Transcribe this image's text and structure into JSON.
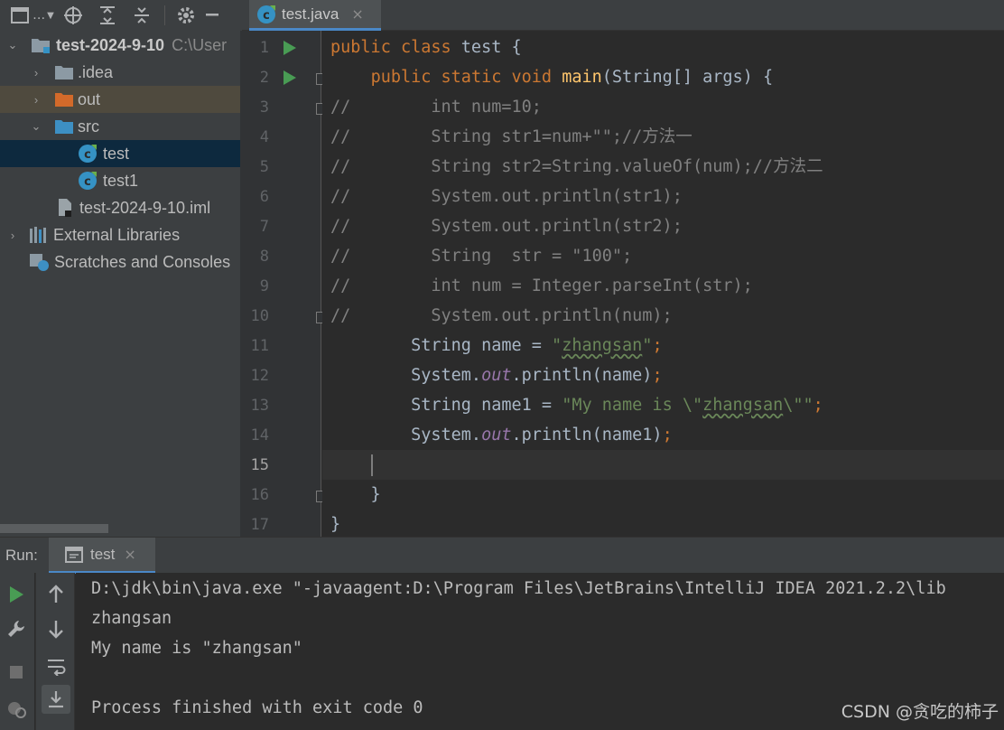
{
  "toolbar": {
    "project_menu": "…"
  },
  "editor_tab": {
    "label": "test.java",
    "close": "×"
  },
  "project_tree": [
    {
      "label": "test-2024-9-10",
      "hint": "C:\\User",
      "chevron": "⌄",
      "icon": "module-folder-icon"
    },
    {
      "label": ".idea",
      "chevron": "›",
      "icon": "folder-icon"
    },
    {
      "label": "out",
      "chevron": "›",
      "icon": "excluded-folder-icon"
    },
    {
      "label": "src",
      "chevron": "⌄",
      "icon": "source-folder-icon"
    },
    {
      "label": "test",
      "icon": "java-class-icon"
    },
    {
      "label": "test1",
      "icon": "java-class-icon"
    },
    {
      "label": "test-2024-9-10.iml",
      "icon": "iml-file-icon"
    },
    {
      "label": "External Libraries",
      "chevron": "›",
      "icon": "libraries-icon"
    },
    {
      "label": "Scratches and Consoles",
      "icon": "scratches-icon"
    }
  ],
  "line_numbers": [
    "1",
    "2",
    "3",
    "4",
    "5",
    "6",
    "7",
    "8",
    "9",
    "10",
    "11",
    "12",
    "13",
    "14",
    "15",
    "16",
    "17"
  ],
  "code": {
    "l1_kw": "public class ",
    "l1_rest": "test {",
    "l2_indent": "    ",
    "l2_kw": "public static void ",
    "l2_fn": "main",
    "l2_rest": "(String[] args) {",
    "l3": "//        int num=10;",
    "l4": "//        String str1=num+\"\";//方法一",
    "l5": "//        String str2=String.valueOf(num);//方法二",
    "l6": "//        System.out.println(str1);",
    "l7": "//        System.out.println(str2);",
    "l8": "//        String  str = \"100\";",
    "l9": "//        int num = Integer.parseInt(str);",
    "l10": "//        System.out.println(num);",
    "l11_a": "        String name = ",
    "l11_q1": "\"",
    "l11_s": "zhangsan",
    "l11_q2": "\"",
    "l11_semi": ";",
    "l12_a": "        System.",
    "l12_f": "out",
    "l12_b": ".println(name)",
    "l12_semi": ";",
    "l13_a": "        String name1 = ",
    "l13_s1": "\"My name is \\\"",
    "l13_s": "zhangsan",
    "l13_s2": "\\\"\"",
    "l13_semi": ";",
    "l14_a": "        System.",
    "l14_f": "out",
    "l14_b": ".println(name1)",
    "l14_semi": ";",
    "l15": "",
    "l16": "    }",
    "l17": "}"
  },
  "run_panel": {
    "title": "Run:",
    "tab_label": "test",
    "tab_close": "×",
    "console": [
      "D:\\jdk\\bin\\java.exe \"-javaagent:D:\\Program Files\\JetBrains\\IntelliJ IDEA 2021.2.2\\lib",
      "zhangsan",
      "My name is \"zhangsan\"",
      "",
      "Process finished with exit code 0"
    ]
  },
  "watermark": "CSDN @贪吃的柿子",
  "colors": {
    "keyword": "#cc7832",
    "string": "#6a8759",
    "comment": "#808080",
    "method": "#ffc66d",
    "field": "#9876aa",
    "accent": "#4a88c7",
    "run_green": "#499c54"
  }
}
